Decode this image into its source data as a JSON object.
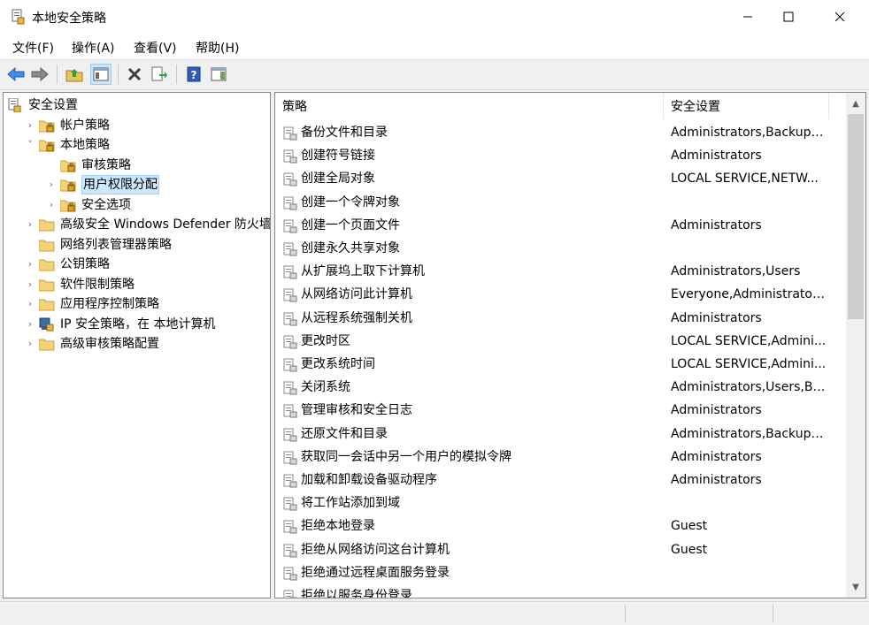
{
  "window": {
    "title": "本地安全策略"
  },
  "menu": [
    "文件(F)",
    "操作(A)",
    "查看(V)",
    "帮助(H)"
  ],
  "tree": [
    {
      "label": "安全设置",
      "level": 0,
      "expander": "",
      "icon": "security-settings-icon"
    },
    {
      "label": "帐户策略",
      "level": 1,
      "expander": "›",
      "icon": "policy-folder-icon"
    },
    {
      "label": "本地策略",
      "level": 1,
      "expander": "˅",
      "icon": "policy-folder-icon"
    },
    {
      "label": "审核策略",
      "level": 2,
      "expander": "",
      "icon": "policy-folder-icon"
    },
    {
      "label": "用户权限分配",
      "level": 2,
      "expander": "›",
      "icon": "policy-folder-icon",
      "selected": true
    },
    {
      "label": "安全选项",
      "level": 2,
      "expander": "›",
      "icon": "policy-folder-icon"
    },
    {
      "label": "高级安全 Windows Defender 防火墙",
      "level": 1,
      "expander": "›",
      "icon": "folder-icon"
    },
    {
      "label": "网络列表管理器策略",
      "level": 1,
      "expander": "",
      "icon": "folder-icon"
    },
    {
      "label": "公钥策略",
      "level": 1,
      "expander": "›",
      "icon": "folder-icon"
    },
    {
      "label": "软件限制策略",
      "level": 1,
      "expander": "›",
      "icon": "folder-icon"
    },
    {
      "label": "应用程序控制策略",
      "level": 1,
      "expander": "›",
      "icon": "folder-icon"
    },
    {
      "label": "IP 安全策略，在 本地计算机",
      "level": 1,
      "expander": "›",
      "icon": "ip-security-icon"
    },
    {
      "label": "高级审核策略配置",
      "level": 1,
      "expander": "›",
      "icon": "folder-icon"
    }
  ],
  "list": {
    "columns": [
      "策略",
      "安全设置"
    ],
    "sort_indicator": "˄",
    "rows": [
      {
        "policy": "备份文件和目录",
        "setting": "Administrators,Backup ..."
      },
      {
        "policy": "创建符号链接",
        "setting": "Administrators"
      },
      {
        "policy": "创建全局对象",
        "setting": "LOCAL SERVICE,NETW..."
      },
      {
        "policy": "创建一个令牌对象",
        "setting": ""
      },
      {
        "policy": "创建一个页面文件",
        "setting": "Administrators"
      },
      {
        "policy": "创建永久共享对象",
        "setting": ""
      },
      {
        "policy": "从扩展坞上取下计算机",
        "setting": "Administrators,Users"
      },
      {
        "policy": "从网络访问此计算机",
        "setting": "Everyone,Administrator..."
      },
      {
        "policy": "从远程系统强制关机",
        "setting": "Administrators"
      },
      {
        "policy": "更改时区",
        "setting": "LOCAL SERVICE,Admini..."
      },
      {
        "policy": "更改系统时间",
        "setting": "LOCAL SERVICE,Admini..."
      },
      {
        "policy": "关闭系统",
        "setting": "Administrators,Users,Ba..."
      },
      {
        "policy": "管理审核和安全日志",
        "setting": "Administrators"
      },
      {
        "policy": "还原文件和目录",
        "setting": "Administrators,Backup ..."
      },
      {
        "policy": "获取同一会话中另一个用户的模拟令牌",
        "setting": "Administrators"
      },
      {
        "policy": "加载和卸载设备驱动程序",
        "setting": "Administrators"
      },
      {
        "policy": "将工作站添加到域",
        "setting": ""
      },
      {
        "policy": "拒绝本地登录",
        "setting": "Guest"
      },
      {
        "policy": "拒绝从网络访问这台计算机",
        "setting": "Guest"
      },
      {
        "policy": "拒绝通过远程桌面服务登录",
        "setting": ""
      },
      {
        "policy": "拒绝以服务身份登录",
        "setting": ""
      }
    ]
  }
}
